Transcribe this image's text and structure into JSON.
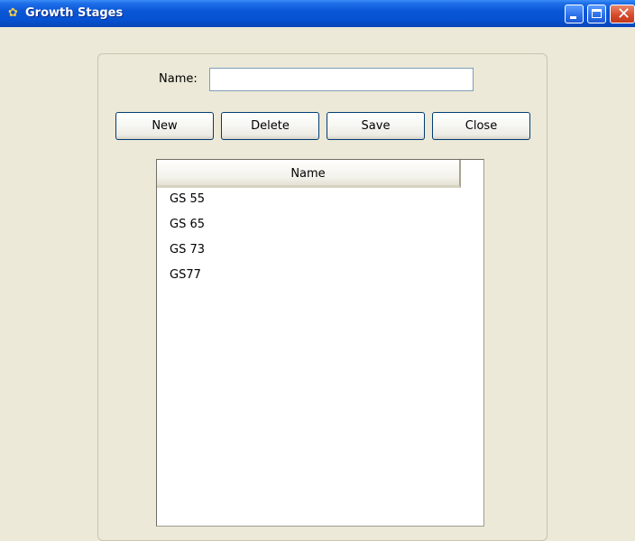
{
  "window": {
    "title": "Growth Stages",
    "icon": "app-icon"
  },
  "form": {
    "name_label": "Name:",
    "name_value": ""
  },
  "buttons": {
    "new": "New",
    "delete": "Delete",
    "save": "Save",
    "close": "Close"
  },
  "list": {
    "columns": [
      "Name"
    ],
    "rows": [
      "GS 55",
      "GS 65",
      "GS 73",
      "GS77"
    ]
  }
}
